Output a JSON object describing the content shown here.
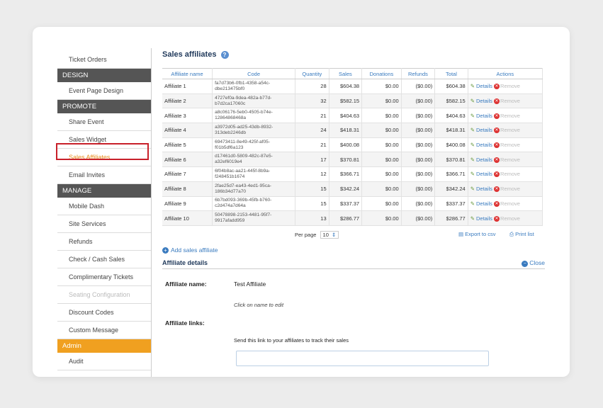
{
  "sidebar": {
    "items": [
      {
        "type": "item",
        "label": "Ticket Orders"
      },
      {
        "type": "head",
        "label": "DESIGN"
      },
      {
        "type": "item",
        "label": "Event Page Design"
      },
      {
        "type": "head",
        "label": "PROMOTE"
      },
      {
        "type": "item",
        "label": "Share Event"
      },
      {
        "type": "item",
        "label": "Sales Widget"
      },
      {
        "type": "item",
        "label": "Sales Affiliates",
        "state": "active"
      },
      {
        "type": "item",
        "label": "Email Invites"
      },
      {
        "type": "head",
        "label": "MANAGE"
      },
      {
        "type": "item",
        "label": "Mobile Dash"
      },
      {
        "type": "item",
        "label": "Site Services"
      },
      {
        "type": "item",
        "label": "Refunds"
      },
      {
        "type": "item",
        "label": "Check / Cash Sales"
      },
      {
        "type": "item",
        "label": "Complimentary Tickets"
      },
      {
        "type": "item",
        "label": "Seating Configuration",
        "state": "disabled"
      },
      {
        "type": "item",
        "label": "Discount Codes"
      },
      {
        "type": "item",
        "label": "Custom Message"
      },
      {
        "type": "head-orange",
        "label": "Admin"
      },
      {
        "type": "item",
        "label": "Audit"
      }
    ]
  },
  "page": {
    "title": "Sales affiliates",
    "help_icon": "help-icon"
  },
  "table": {
    "columns": [
      "Affiliate name",
      "Code",
      "Quantity",
      "Sales",
      "Donations",
      "Refunds",
      "Total",
      "Actions"
    ],
    "rows": [
      {
        "name": "Affiliate 1",
        "code": "fa7d73b6-0fb1-4358-a54c-dbe213475bf0",
        "qty": "28",
        "sales": "$604.38",
        "donations": "$0.00",
        "refunds": "($0.00)",
        "total": "$604.38"
      },
      {
        "name": "Affiliate 2",
        "code": "4727ef0a-9dea-482a-b77d-b7d2ca17060c",
        "qty": "32",
        "sales": "$582.15",
        "donations": "$0.00",
        "refunds": "($0.00)",
        "total": "$582.15"
      },
      {
        "name": "Affiliate 3",
        "code": "a8c06176-5eb0-4505-b74e-12864868468a",
        "qty": "21",
        "sales": "$404.63",
        "donations": "$0.00",
        "refunds": "($0.00)",
        "total": "$404.63"
      },
      {
        "name": "Affiliate 4",
        "code": "a3972d05-ad25-43db-8932-313deb2246db",
        "qty": "24",
        "sales": "$418.31",
        "donations": "$0.00",
        "refunds": "($0.00)",
        "total": "$418.31"
      },
      {
        "name": "Affiliate 5",
        "code": "69473411-8e49-425f-af05-f01b5df6a123",
        "qty": "21",
        "sales": "$400.08",
        "donations": "$0.00",
        "refunds": "($0.00)",
        "total": "$400.08"
      },
      {
        "name": "Affiliate 6",
        "code": "d17461d0-5809-482c-87e5-a32ef6019e4",
        "qty": "17",
        "sales": "$370.81",
        "donations": "$0.00",
        "refunds": "($0.00)",
        "total": "$370.81"
      },
      {
        "name": "Affiliate 7",
        "code": "6f04b8ac-aa21-445f-8b9a-f248451b1674",
        "qty": "12",
        "sales": "$366.71",
        "donations": "$0.00",
        "refunds": "($0.00)",
        "total": "$366.71"
      },
      {
        "name": "Affiliate 8",
        "code": "2fae25d7-ea43-4ed1-95ca-186b34d77a70",
        "qty": "15",
        "sales": "$342.24",
        "donations": "$0.00",
        "refunds": "($0.00)",
        "total": "$342.24"
      },
      {
        "name": "Affiliate 9",
        "code": "6b7bd093-369b-45fb-b760-c2d474a7d64a",
        "qty": "15",
        "sales": "$337.37",
        "donations": "$0.00",
        "refunds": "($0.00)",
        "total": "$337.37"
      },
      {
        "name": "Affiliate 10",
        "code": "50478898-2153-4481-95f7-9917afadd959",
        "qty": "13",
        "sales": "$286.77",
        "donations": "$0.00",
        "refunds": "($0.00)",
        "total": "$286.77"
      }
    ],
    "details_label": "Details",
    "remove_label": "Remove"
  },
  "pager": {
    "per_page_label": "Per page",
    "per_page_value": "10",
    "export_label": "Export to csv",
    "print_label": "Print list"
  },
  "add_affiliate_label": "Add sales affiliate",
  "details": {
    "title": "Affiliate details",
    "close_label": "Close",
    "name_label": "Affiliate name:",
    "name_value": "Test Affiliate",
    "edit_hint": "Click on name to edit",
    "links_label": "Affiliate links:",
    "links_hint": "Send this link to your affiliates to track their sales"
  }
}
